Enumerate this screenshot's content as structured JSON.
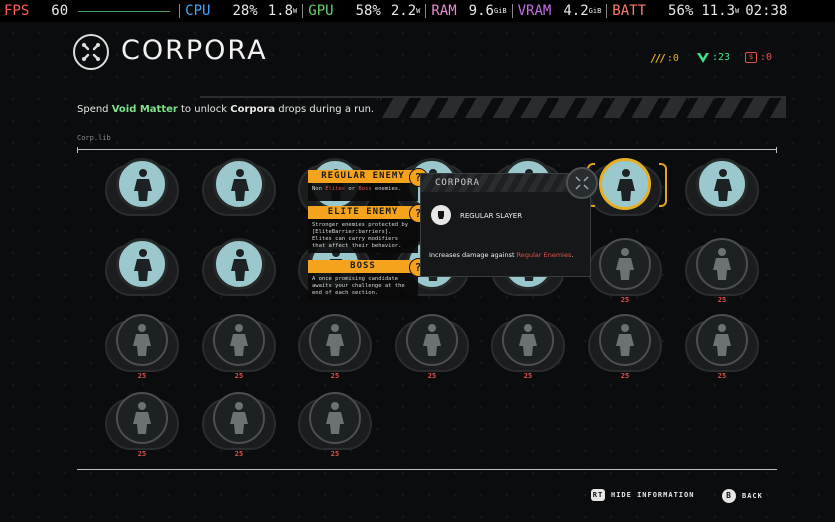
{
  "osd": {
    "fps_label": "FPS",
    "fps_value": "60",
    "cpu_label": "CPU",
    "cpu_usage": "28%",
    "cpu_power": "1.8",
    "cpu_power_unit": "W",
    "gpu_label": "GPU",
    "gpu_usage": "58%",
    "gpu_power": "2.2",
    "gpu_power_unit": "W",
    "ram_label": "RAM",
    "ram_value": "9.6",
    "ram_unit": "GiB",
    "vram_label": "VRAM",
    "vram_value": "4.2",
    "vram_unit": "GiB",
    "batt_label": "BATT",
    "batt_percent": "56%",
    "batt_power": "11.3",
    "batt_power_unit": "W",
    "clock": "02:38"
  },
  "header": {
    "title": "CORPORA",
    "resources": [
      {
        "icon": "claw-marks-icon",
        "value": ":0",
        "color": "#e3b023"
      },
      {
        "icon": "void-matter-icon",
        "value": ":23",
        "color": "#3fe08b"
      },
      {
        "icon": "currency-icon",
        "value": ":0",
        "color": "#e0524f"
      }
    ]
  },
  "intro": {
    "part1": "Spend ",
    "void_matter": "Void Matter",
    "part2": " to unlock ",
    "corpora": "Corpora",
    "part3": " drops during a run."
  },
  "section_label": "Corp.lib",
  "tiles": [
    {
      "name": "corpus-1",
      "state": "unlocked",
      "cost": ""
    },
    {
      "name": "corpus-2",
      "state": "unlocked",
      "cost": ""
    },
    {
      "name": "corpus-3",
      "state": "unlocked",
      "cost": ""
    },
    {
      "name": "corpus-4",
      "state": "unlocked",
      "cost": ""
    },
    {
      "name": "corpus-5",
      "state": "unlocked",
      "cost": ""
    },
    {
      "name": "corpus-6",
      "state": "selected",
      "cost": ""
    },
    {
      "name": "corpus-7",
      "state": "unlocked",
      "cost": ""
    },
    {
      "name": "corpus-8",
      "state": "unlocked",
      "cost": ""
    },
    {
      "name": "corpus-9",
      "state": "unlocked",
      "cost": ""
    },
    {
      "name": "corpus-10",
      "state": "unlocked",
      "cost": ""
    },
    {
      "name": "corpus-11",
      "state": "unlocked",
      "cost": ""
    },
    {
      "name": "corpus-12",
      "state": "unlocked",
      "cost": ""
    },
    {
      "name": "corpus-13",
      "state": "locked",
      "cost": "25"
    },
    {
      "name": "corpus-14",
      "state": "locked",
      "cost": "25"
    },
    {
      "name": "corpus-15",
      "state": "locked",
      "cost": "25"
    },
    {
      "name": "corpus-16",
      "state": "locked",
      "cost": "25"
    },
    {
      "name": "corpus-17",
      "state": "locked",
      "cost": "25"
    },
    {
      "name": "corpus-18",
      "state": "locked",
      "cost": "25"
    },
    {
      "name": "corpus-19",
      "state": "locked",
      "cost": "25"
    },
    {
      "name": "corpus-20",
      "state": "locked",
      "cost": "25"
    },
    {
      "name": "corpus-21",
      "state": "locked",
      "cost": "25"
    },
    {
      "name": "corpus-22",
      "state": "locked",
      "cost": "25"
    },
    {
      "name": "corpus-23",
      "state": "locked",
      "cost": "25"
    },
    {
      "name": "corpus-24",
      "state": "locked",
      "cost": "25"
    }
  ],
  "legend": {
    "regular": {
      "title": "REGULAR ENEMY",
      "body_pre": "Non ",
      "elites": "Elites",
      "or": " or ",
      "boss": "Boss",
      "body_post": " enemies."
    },
    "elite": {
      "title": "ELITE ENEMY",
      "body": "Stronger enemies protected by [EliteBarrier:barriers]. Elites can carry modifiers that affect their behavior."
    },
    "boss": {
      "title": "BOSS",
      "body": "A once promising candidate awaits your challenge at the end of each section."
    },
    "question_mark": "?"
  },
  "detail": {
    "header": "CORPORA",
    "name": "REGULAR SLAYER",
    "desc_pre": "Increases damage against ",
    "desc_highlight": "Regular Enemies",
    "desc_post": "."
  },
  "footer": {
    "hide_button": "RT",
    "hide_label": "HIDE INFORMATION",
    "back_button": "B",
    "back_label": "BACK"
  }
}
